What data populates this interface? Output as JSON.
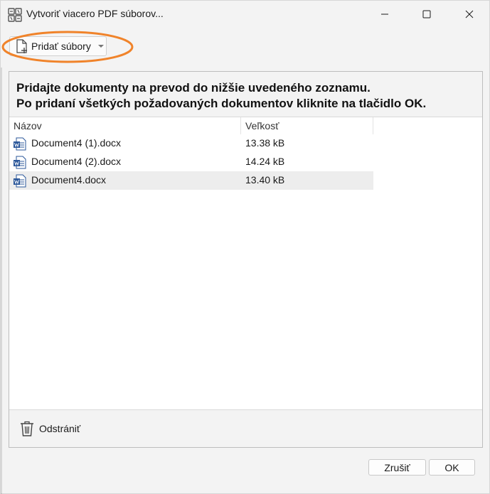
{
  "window": {
    "title": "Vytvoriť viacero PDF súborov...",
    "controls": {
      "minimize": "minimize-icon",
      "maximize": "maximize-icon",
      "close": "close-icon"
    }
  },
  "toolbar": {
    "add_files_label": "Pridať súbory",
    "add_files_icon": "file-plus-icon",
    "highlight_color": "#F0832A"
  },
  "instructions": {
    "line1": "Pridajte dokumenty na prevod do nižšie uvedeného zoznamu.",
    "line2": "Po pridaní všetkých požadovaných dokumentov kliknite na tlačidlo OK."
  },
  "file_list": {
    "columns": {
      "name": "Názov",
      "size": "Veľkosť"
    },
    "rows": [
      {
        "name": "Document4 (1).docx",
        "size": "13.38 kB",
        "icon": "word-doc-icon"
      },
      {
        "name": "Document4 (2).docx",
        "size": "14.24 kB",
        "icon": "word-doc-icon"
      },
      {
        "name": "Document4.docx",
        "size": "13.40 kB",
        "icon": "word-doc-icon",
        "selected": true
      }
    ]
  },
  "actions": {
    "remove_label": "Odstrániť",
    "remove_icon": "trash-icon"
  },
  "footer": {
    "cancel_label": "Zrušiť",
    "ok_label": "OK"
  },
  "colors": {
    "word_blue": "#2B579A",
    "selected_row": "#EDEDED",
    "window_bg": "#F3F3F3"
  }
}
